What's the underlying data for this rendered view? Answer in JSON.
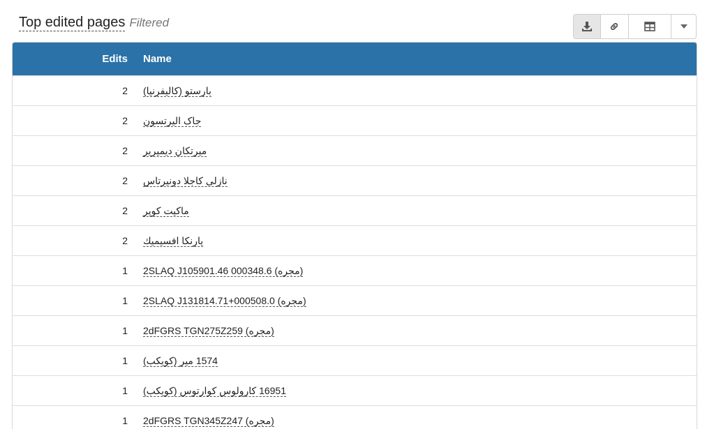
{
  "header": {
    "title": "Top edited pages",
    "subtitle": "Filtered"
  },
  "toolbar": {
    "icons": [
      "download-icon",
      "link-icon",
      "table-icon",
      "caret-down-icon"
    ]
  },
  "table": {
    "columns": [
      "Edits",
      "Name"
    ],
    "rows": [
      {
        "edits": "2",
        "name": "بارستو (کالیفرنیا)"
      },
      {
        "edits": "2",
        "name": "جاک الیرتسون"
      },
      {
        "edits": "2",
        "name": "میرتکان دیمیریر"
      },
      {
        "edits": "2",
        "name": "نازلی کاجلا دونیرتاس"
      },
      {
        "edits": "2",
        "name": "ماکیت کوپر"
      },
      {
        "edits": "2",
        "name": "یارنکا افسیمیك"
      },
      {
        "edits": "1",
        "name": "2SLAQ J105901.46 000348.6 (مجره)"
      },
      {
        "edits": "1",
        "name": "2SLAQ J131814.71+000508.0 (مجره)"
      },
      {
        "edits": "1",
        "name": "2dFGRS TGN275Z259 (مجره)"
      },
      {
        "edits": "1",
        "name": "1574 میر (کویکب)"
      },
      {
        "edits": "1",
        "name": "16951 کارولوس کوارتوس (کویکب)"
      },
      {
        "edits": "1",
        "name": "2dFGRS TGN345Z247 (مجره)"
      }
    ]
  }
}
